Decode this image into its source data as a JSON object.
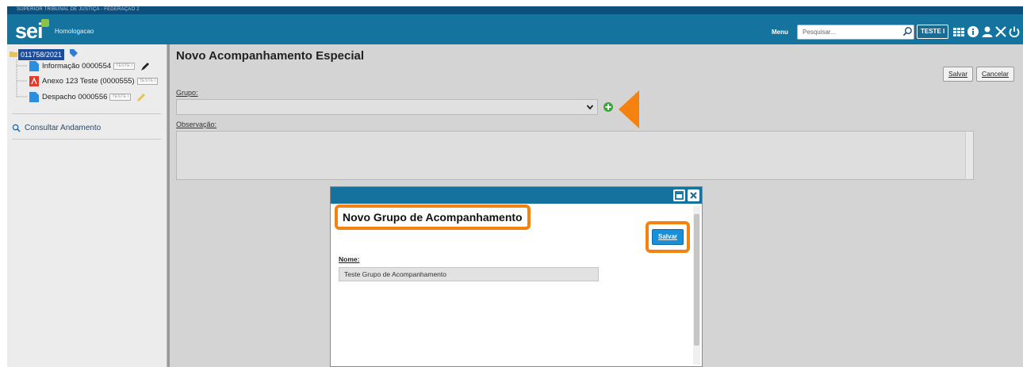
{
  "topbar": {
    "org_text": "SUPERIOR TRIBUNAL DE JUSTIÇA - FEDERAÇÃO 2"
  },
  "header": {
    "logo": "sei",
    "environment": "Homologacao",
    "menu_label": "Menu",
    "search_placeholder": "Pesquisar...",
    "unit_button": "TESTE I"
  },
  "sidebar": {
    "process_number": "011758/2021",
    "documents": [
      {
        "label": "Informação 0000554",
        "tag": "TESTE I",
        "icon": "document-icon"
      },
      {
        "label": "Anexo 123 Teste (0000555)",
        "tag": "TESTE I",
        "icon": "pdf-icon"
      },
      {
        "label": "Despacho 0000556",
        "tag": "TESTE I",
        "icon": "document-icon"
      }
    ],
    "consult_label": "Consultar Andamento"
  },
  "main": {
    "title": "Novo Acompanhamento Especial",
    "save_label": "Salvar",
    "cancel_label": "Cancelar",
    "group_label": "Grupo:",
    "group_value": "",
    "observation_label": "Observação:",
    "observation_value": ""
  },
  "modal": {
    "title": "Novo Grupo de Acompanhamento",
    "save_label": "Salvar",
    "name_label": "Nome:",
    "name_value": "Teste Grupo de Acompanhamento"
  },
  "colors": {
    "header_blue": "#14749e",
    "highlight_orange": "#f5820f",
    "save_blue": "#1a8fd6"
  }
}
